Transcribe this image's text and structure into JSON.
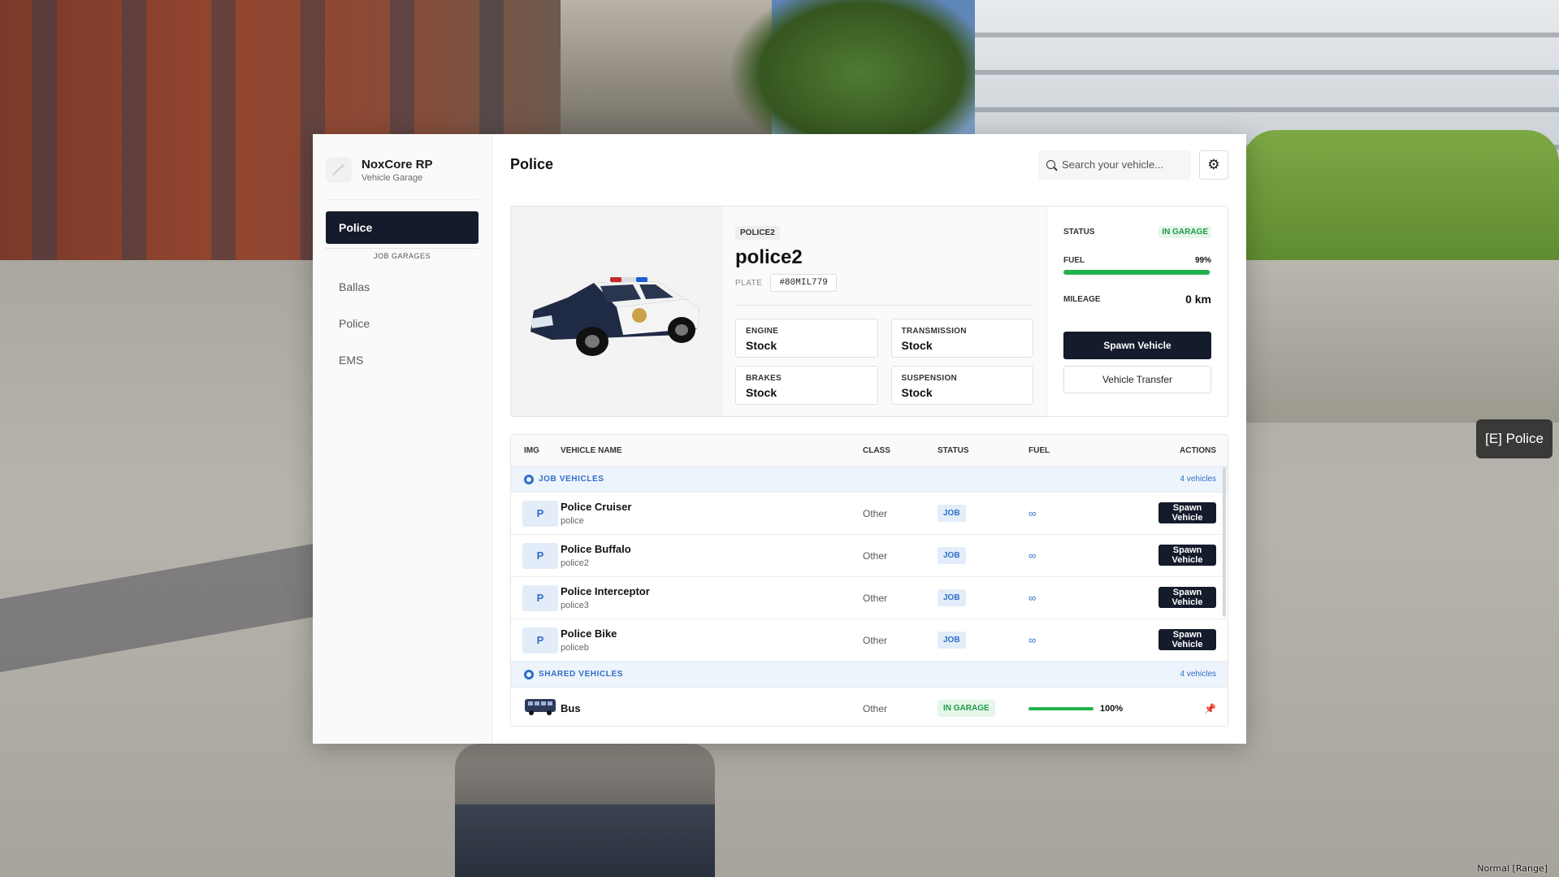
{
  "background": {
    "prompt_label": "[E] Police",
    "mode_text": "Normal [Range]"
  },
  "sidebar": {
    "brand_title": "NoxCore RP",
    "brand_subtitle": "Vehicle Garage",
    "active_item": "Police",
    "section_label": "JOB GARAGES",
    "items": [
      {
        "label": "Ballas"
      },
      {
        "label": "Police"
      },
      {
        "label": "EMS"
      }
    ]
  },
  "header": {
    "title": "Police",
    "search_placeholder": "Search your vehicle...",
    "settings_icon": "gear-icon"
  },
  "detail": {
    "model_tag": "POLICE2",
    "name": "police2",
    "plate_label": "PLATE",
    "plate": "#80MIL779",
    "upgrades": [
      {
        "label": "ENGINE",
        "value": "Stock"
      },
      {
        "label": "TRANSMISSION",
        "value": "Stock"
      },
      {
        "label": "BRAKES",
        "value": "Stock"
      },
      {
        "label": "SUSPENSION",
        "value": "Stock"
      }
    ],
    "status_label": "STATUS",
    "status_value": "IN GARAGE",
    "fuel_label": "FUEL",
    "fuel_value": "99%",
    "fuel_fraction": 0.99,
    "mileage_label": "MILEAGE",
    "mileage_value": "0 km",
    "spawn_label": "Spawn Vehicle",
    "transfer_label": "Vehicle Transfer"
  },
  "table": {
    "headers": {
      "img": "IMG",
      "name": "VEHICLE NAME",
      "class": "CLASS",
      "status": "STATUS",
      "fuel": "FUEL",
      "actions": "ACTIONS"
    },
    "job_group": {
      "label": "JOB VEHICLES",
      "count": "4 vehicles",
      "rows": [
        {
          "badge": "P",
          "name": "Police Cruiser",
          "model": "police",
          "class": "Other",
          "status": "JOB",
          "fuel": "∞",
          "action": "Spawn Vehicle"
        },
        {
          "badge": "P",
          "name": "Police Buffalo",
          "model": "police2",
          "class": "Other",
          "status": "JOB",
          "fuel": "∞",
          "action": "Spawn Vehicle"
        },
        {
          "badge": "P",
          "name": "Police Interceptor",
          "model": "police3",
          "class": "Other",
          "status": "JOB",
          "fuel": "∞",
          "action": "Spawn Vehicle"
        },
        {
          "badge": "P",
          "name": "Police Bike",
          "model": "policeb",
          "class": "Other",
          "status": "JOB",
          "fuel": "∞",
          "action": "Spawn Vehicle"
        }
      ]
    },
    "shared_group": {
      "label": "SHARED VEHICLES",
      "count": "4 vehicles",
      "rows": [
        {
          "name": "Bus",
          "class": "Other",
          "status": "IN GARAGE",
          "fuel": "100%",
          "fuel_fraction": 1.0,
          "action_icon": "pin-icon"
        }
      ]
    }
  },
  "colors": {
    "primary_dark": "#141b2a",
    "accent_blue": "#2f6ec7",
    "status_green": "#1f9a48",
    "fuel_green": "#23b24f"
  }
}
